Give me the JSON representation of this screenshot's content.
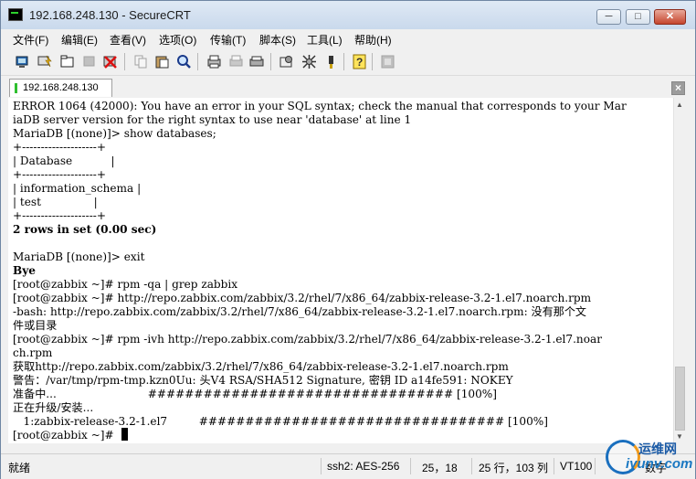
{
  "window": {
    "title": "192.168.248.130 - SecureCRT"
  },
  "window_controls": {
    "minimize": "─",
    "maximize": "□",
    "close": "✕"
  },
  "menu": [
    "文件(F)",
    "编辑(E)",
    "查看(V)",
    "选项(O)",
    "传输(T)",
    "脚本(S)",
    "工具(L)",
    "帮助(H)"
  ],
  "toolbar": {
    "icons": [
      "connect-icon",
      "quick-connect-icon",
      "connect-tab-icon",
      "reconnect-icon",
      "disconnect-icon",
      "copy-icon",
      "paste-icon",
      "find-icon",
      "print-icon",
      "print-selection-icon",
      "print-setup-icon",
      "session-options-icon",
      "global-options-icon",
      "keymap-icon",
      "help-icon",
      "sftp-icon"
    ]
  },
  "tab": {
    "label": "192.168.248.130",
    "close": "×"
  },
  "terminal": {
    "lines": [
      "ERROR 1064 (42000): You have an error in your SQL syntax; check the manual that corresponds to your Mar",
      "iaDB server version for the right syntax to use near 'database' at line 1",
      "MariaDB [(none)]> show databases;",
      "+--------------------+",
      "| Database           |",
      "+--------------------+",
      "| information_schema |",
      "| test               |",
      "+--------------------+",
      "2 rows in set (0.00 sec)",
      "",
      "MariaDB [(none)]> exit",
      "Bye",
      "[root@zabbix ~]# rpm -qa | grep zabbix",
      "[root@zabbix ~]# http://repo.zabbix.com/zabbix/3.2/rhel/7/x86_64/zabbix-release-3.2-1.el7.noarch.rpm",
      "-bash: http://repo.zabbix.com/zabbix/3.2/rhel/7/x86_64/zabbix-release-3.2-1.el7.noarch.rpm: 没有那个文",
      "件或目录",
      "[root@zabbix ~]# rpm -ivh http://repo.zabbix.com/zabbix/3.2/rhel/7/x86_64/zabbix-release-3.2-1.el7.noar",
      "ch.rpm",
      "获取http://repo.zabbix.com/zabbix/3.2/rhel/7/x86_64/zabbix-release-3.2-1.el7.noarch.rpm",
      "警告：/var/tmp/rpm-tmp.kzn0Uu: 头V4 RSA/SHA512 Signature, 密钥 ID a14fe591: NOKEY",
      "准备中...                          ################################# [100%]",
      "正在升级/安装...",
      "   1:zabbix-release-3.2-1.el7         ################################# [100%]",
      "[root@zabbix ~]# "
    ],
    "bold_lines": [
      9,
      12
    ]
  },
  "statusbar": {
    "ready": "就绪",
    "cipher": "ssh2: AES-256",
    "cursor": "25，18",
    "size": "25 行，103 列",
    "term": "VT100",
    "num": "数字"
  },
  "watermark": {
    "line1": "运维网",
    "line2": "iyunv.com"
  }
}
